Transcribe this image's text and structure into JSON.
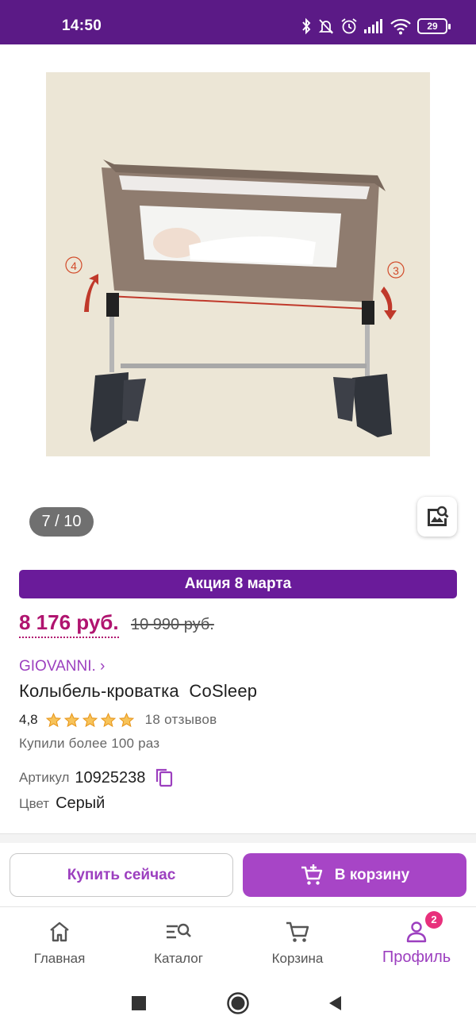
{
  "status_bar": {
    "time": "14:50",
    "battery": "29",
    "icons": [
      "bluetooth-icon",
      "bell-off-icon",
      "alarm-icon",
      "signal-icon",
      "wifi-icon",
      "battery-icon"
    ]
  },
  "product": {
    "image_name": "cosleep-crib-photo",
    "photo_counter": "7 / 10",
    "image_markers": [
      "4",
      "3"
    ],
    "promo": "Акция 8 марта",
    "price_current": "8 176 руб.",
    "price_old": "10 990 руб.",
    "brand": "GIOVANNI. ›",
    "title": "Колыбель-кроватка  CoSleep",
    "rating": "4,8",
    "rating_stars": 5,
    "reviews": "18 отзывов",
    "purchases": "Купили более 100 раз",
    "article_label": "Артикул",
    "article_value": "10925238",
    "color_label": "Цвет",
    "color_value": "Серый"
  },
  "actions": {
    "buy_now": "Купить сейчас",
    "add_to_cart": "В корзину"
  },
  "bottom_nav": {
    "items": [
      {
        "label": "Главная",
        "icon": "home-icon"
      },
      {
        "label": "Каталог",
        "icon": "catalog-search-icon"
      },
      {
        "label": "Корзина",
        "icon": "cart-icon"
      },
      {
        "label": "Профиль",
        "icon": "profile-icon",
        "badge": "2",
        "active": true
      }
    ]
  },
  "colors": {
    "brand_purple": "#5b1a86",
    "promo_purple": "#6a1b9a",
    "accent_purple": "#a745c6",
    "price_magenta": "#b0146f",
    "star_orange": "#f5a623",
    "badge_pink": "#e8307c"
  }
}
